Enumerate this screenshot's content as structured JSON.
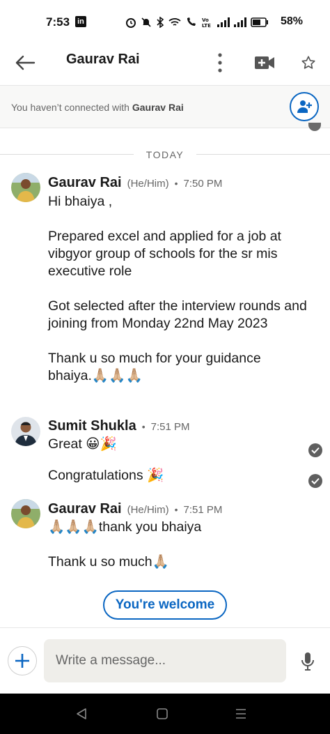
{
  "status_bar": {
    "time": "7:53",
    "app_badge": "in",
    "battery": "58%"
  },
  "header": {
    "title": "Gaurav Rai"
  },
  "connect_banner": {
    "text_prefix": "You haven’t connected with ",
    "name": "Gaurav Rai"
  },
  "divider": {
    "label": "TODAY"
  },
  "messages": [
    {
      "sender": "Gaurav Rai",
      "pronouns": "(He/Him)",
      "separator": "•",
      "time": "7:50 PM",
      "body": "Hi bhaiya ,\n\nPrepared excel and applied for a job at vibgyor group of schools for the sr mis executive role\n\nGot selected after the interview rounds and joining from Monday 22nd May 2023\n\nThank u so much for your guidance bhaiya.🙏🏼🙏🏼🙏🏼"
    },
    {
      "sender": "Sumit Shukla",
      "separator": "•",
      "time": "7:51 PM",
      "body_1": "Great 😀🎉",
      "body_2": "Congratulations 🎉"
    },
    {
      "sender": "Gaurav Rai",
      "pronouns": "(He/Him)",
      "separator": "•",
      "time": "7:51 PM",
      "body": "🙏🏼🙏🏼🙏🏼thank you bhaiya\n\nThank u so much🙏🏼"
    }
  ],
  "quick_reply": {
    "label": "You're welcome"
  },
  "compose": {
    "placeholder": "Write a message..."
  },
  "colors": {
    "brand_blue": "#0a66c2",
    "text_primary": "#191919",
    "text_secondary": "#666666",
    "input_bg": "#efeeea"
  }
}
